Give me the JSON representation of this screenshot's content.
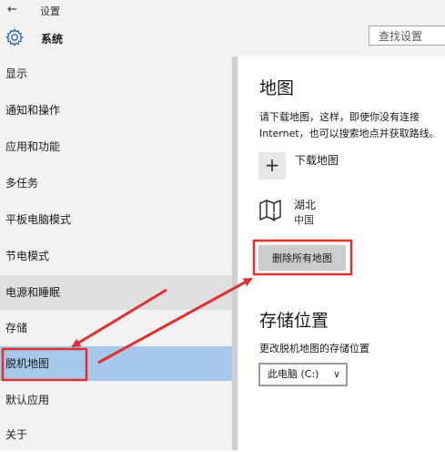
{
  "window": {
    "title": "设置",
    "back_icon": "←"
  },
  "header": {
    "app_name": "系统",
    "search_placeholder": "查找设置"
  },
  "sidebar": {
    "items": [
      {
        "label": "显示"
      },
      {
        "label": "通知和操作"
      },
      {
        "label": "应用和功能"
      },
      {
        "label": "多任务"
      },
      {
        "label": "平板电脑模式"
      },
      {
        "label": "节电模式"
      },
      {
        "label": "电源和睡眠"
      },
      {
        "label": "存储"
      },
      {
        "label": "脱机地图"
      },
      {
        "label": "默认应用"
      },
      {
        "label": "关于"
      }
    ],
    "selected_index": 8
  },
  "main": {
    "title": "地图",
    "description": "请下载地图，这样，即使你没有连接 Internet，也可以搜索地点并获取路线。",
    "download_label": "下载地图",
    "plus_icon": "+",
    "region_name": "湖北",
    "region_country": "中国",
    "delete_all_label": "删除所有地图",
    "storage_title": "存储位置",
    "storage_desc": "更改脱机地图的存储位置",
    "storage_value": "此电脑 (C:)",
    "storage_chevron": "∨"
  },
  "colors": {
    "selected": "#a6c8ea",
    "annotation": "#e03030",
    "sidebar_bg": "#f2f2f2"
  }
}
